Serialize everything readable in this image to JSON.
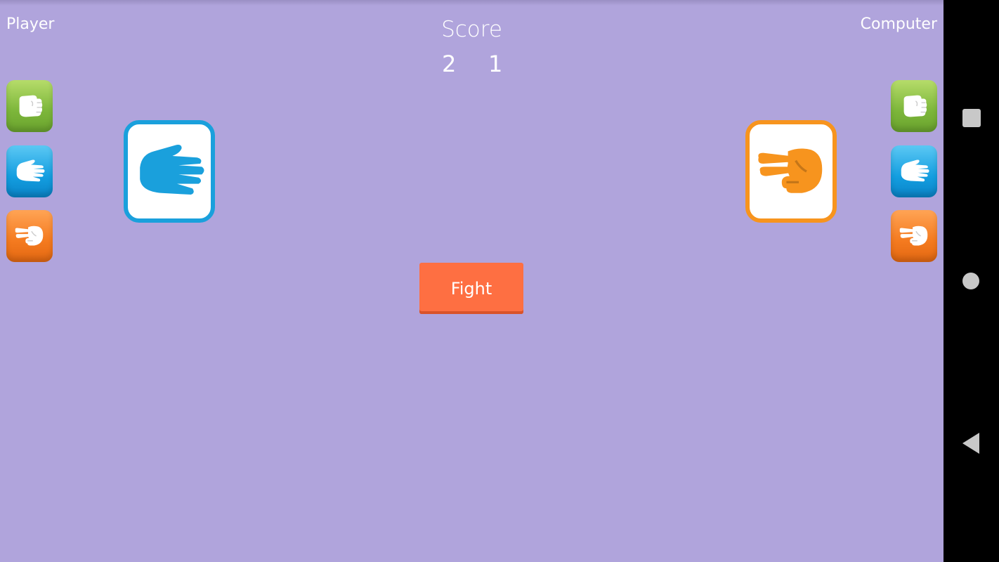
{
  "header": {
    "player_label": "Player",
    "computer_label": "Computer",
    "score_title": "Score",
    "player_score": "2",
    "computer_score": "1"
  },
  "player": {
    "choices": [
      "rock",
      "paper",
      "scissors"
    ],
    "selected": "paper",
    "selected_color": "#1aa0dc"
  },
  "computer": {
    "choices": [
      "rock",
      "paper",
      "scissors"
    ],
    "selected": "scissors",
    "selected_color": "#f7941e"
  },
  "fight_button": {
    "label": "Fight",
    "color": "#fe6f42"
  },
  "navigation": {
    "buttons": [
      "recents-square-icon",
      "home-circle-icon",
      "back-triangle-icon"
    ]
  },
  "background": "#b0a4dc"
}
